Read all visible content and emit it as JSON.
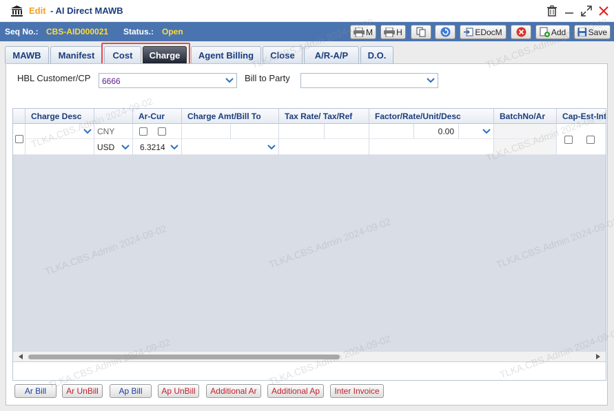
{
  "window": {
    "edit_label": "Edit",
    "title": "- AI Direct MAWB",
    "icons": [
      "bank-icon",
      "trash-icon",
      "minimize-icon",
      "maximize-icon",
      "close-icon"
    ]
  },
  "seqbar": {
    "seq_label": "Seq No.:",
    "seq_value": "CBS-AID000021",
    "status_label": "Status.:",
    "status_value": "Open",
    "print_m": "M",
    "print_h": "H",
    "edocm": "EDocM",
    "add": "Add",
    "save": "Save"
  },
  "tabs": [
    "MAWB",
    "Manifest",
    "Cost",
    "Charge",
    "Agent Billing",
    "Close",
    "A/R-A/P",
    "D.O."
  ],
  "active_tab": "Charge",
  "form": {
    "hbl_label": "HBL Customer/CP",
    "hbl_value": "6666",
    "bill_to_label": "Bill to Party",
    "bill_to_value": ""
  },
  "grid": {
    "headers": [
      "Charge Desc",
      "Ar-Cur",
      "Charge Amt/Bill To",
      "Tax Rate/ Tax/Ref",
      "Factor/Rate/Unit/Desc",
      "BatchNo/Ar",
      "Cap-Est-Int"
    ],
    "row": {
      "cur_top": "CNY",
      "cur_bottom": "USD",
      "rate": "6.3214",
      "factor": "0.00"
    }
  },
  "buttons": [
    "Ar Bill",
    "Ar UnBill",
    "Ap Bill",
    "Ap UnBill",
    "Additional Ar",
    "Additional Ap",
    "Inter Invoice"
  ],
  "colors": {
    "seqbar_bg": "#4a74b0",
    "highlight": "#ffdd33",
    "edit_label": "#f0a020",
    "tab_text": "#1a3d7c",
    "red_btn_text": "#c0202a",
    "blue_btn_text": "#1a3da0"
  },
  "watermark": "TLKA.CBS.Admin 2024-09-02"
}
